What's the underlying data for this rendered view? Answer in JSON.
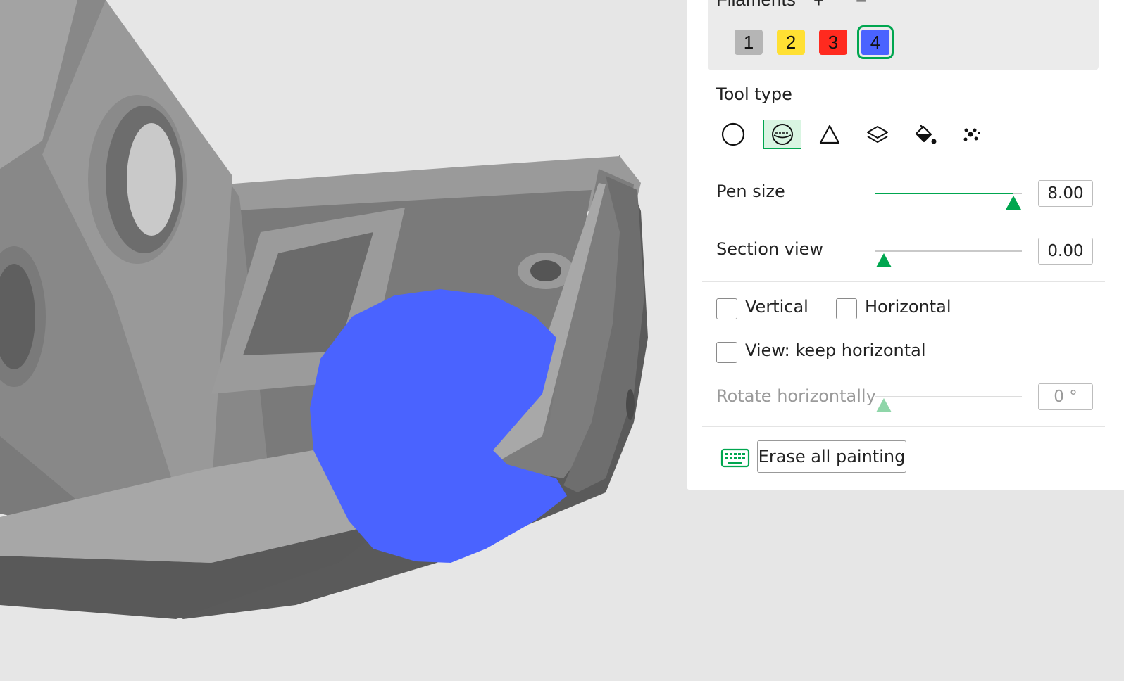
{
  "filaments": {
    "header": "Filaments",
    "add_symbol": "+",
    "remove_symbol": "−",
    "items": [
      {
        "label": "1",
        "color": "#b5b5b5",
        "selected": false
      },
      {
        "label": "2",
        "color": "#ffe033",
        "selected": false
      },
      {
        "label": "3",
        "color": "#ff2a1f",
        "selected": false
      },
      {
        "label": "4",
        "color": "#4a63ff",
        "selected": true
      }
    ]
  },
  "tool_type": {
    "label": "Tool type",
    "tools": [
      {
        "icon": "circle-icon",
        "selected": false
      },
      {
        "icon": "sphere-icon",
        "selected": true
      },
      {
        "icon": "triangle-icon",
        "selected": false
      },
      {
        "icon": "layers-icon",
        "selected": false
      },
      {
        "icon": "fill-bucket-icon",
        "selected": false
      },
      {
        "icon": "gap-fill-icon",
        "selected": false
      }
    ]
  },
  "pen_size": {
    "label": "Pen size",
    "value": "8.00",
    "fraction": 0.93
  },
  "section_view": {
    "label": "Section view",
    "value": "0.00",
    "fraction": 0.0
  },
  "checkboxes": {
    "vertical": {
      "label": "Vertical",
      "checked": false
    },
    "horizontal": {
      "label": "Horizontal",
      "checked": false
    },
    "keep_horizontal": {
      "label": "View: keep horizontal",
      "checked": false
    }
  },
  "rotate_horizontally": {
    "label": "Rotate horizontally",
    "value": "0 °",
    "fraction": 0.0,
    "disabled": true
  },
  "erase_button": {
    "label": "Erase all painting"
  },
  "keyboard_icon": "keyboard-icon",
  "colors": {
    "accent": "#00a64f",
    "paint": "#4a63ff",
    "model": "#8c8c8c",
    "background": "#e6e6e6"
  }
}
